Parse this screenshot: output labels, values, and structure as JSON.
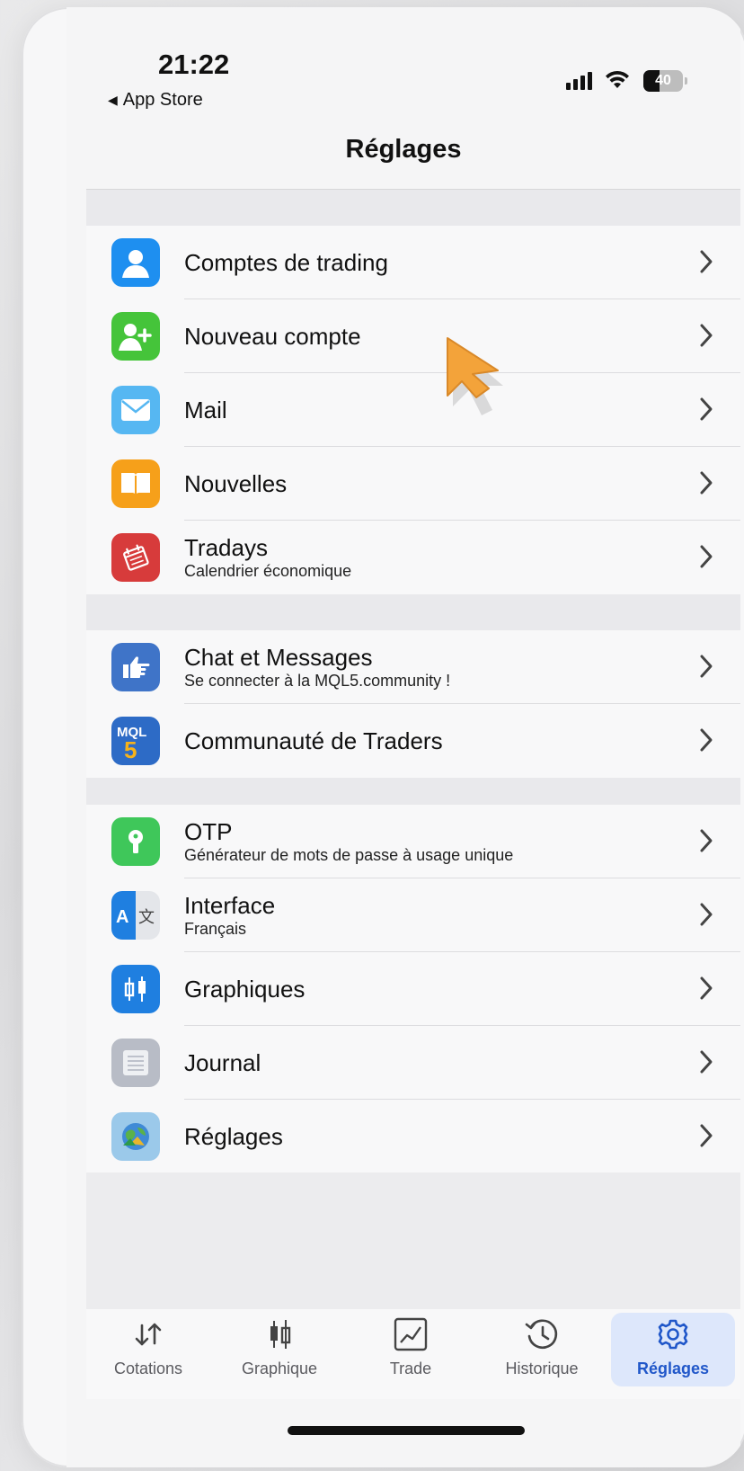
{
  "status_bar": {
    "time": "21:22",
    "back_label": "App Store",
    "battery": "40"
  },
  "nav": {
    "title": "Réglages"
  },
  "groups": [
    {
      "items": [
        {
          "title": "Comptes de trading",
          "subtitle": "",
          "icon": "person-icon",
          "color": "#1e8ff0"
        },
        {
          "title": "Nouveau compte",
          "subtitle": "",
          "icon": "add-person-icon",
          "color": "#45c43a"
        },
        {
          "title": "Mail",
          "subtitle": "",
          "icon": "mail-icon",
          "color": "#56b7f2"
        },
        {
          "title": "Nouvelles",
          "subtitle": "",
          "icon": "book-icon",
          "color": "#f6a01a"
        },
        {
          "title": "Tradays",
          "subtitle": "Calendrier économique",
          "icon": "calendar-icon",
          "color": "#d73b3b"
        }
      ]
    },
    {
      "items": [
        {
          "title": "Chat et Messages",
          "subtitle": "Se connecter à la MQL5.community !",
          "icon": "hand-pointer-icon",
          "color": "#3f74c8"
        },
        {
          "title": "Communauté de Traders",
          "subtitle": "",
          "icon": "mql5-icon",
          "color": "#2d6bc6"
        }
      ]
    },
    {
      "items": [
        {
          "title": "OTP",
          "subtitle": "Générateur de mots de passe à usage unique",
          "icon": "key-icon",
          "color": "#3fc75a"
        },
        {
          "title": "Interface",
          "subtitle": "Français",
          "icon": "translate-icon",
          "color": "#1f7fe0"
        },
        {
          "title": "Graphiques",
          "subtitle": "",
          "icon": "candles-icon",
          "color": "#1f7fe0"
        },
        {
          "title": "Journal",
          "subtitle": "",
          "icon": "journal-icon",
          "color": "#b8bcc6"
        },
        {
          "title": "Réglages",
          "subtitle": "",
          "icon": "metatrader-icon",
          "color": "#9bc9ea"
        }
      ]
    }
  ],
  "tabbar": {
    "tabs": [
      {
        "label": "Cotations",
        "icon": "arrows-updown-icon"
      },
      {
        "label": "Graphique",
        "icon": "candlestick-icon"
      },
      {
        "label": "Trade",
        "icon": "trade-chart-icon"
      },
      {
        "label": "Historique",
        "icon": "history-icon"
      },
      {
        "label": "Réglages",
        "icon": "gear-icon",
        "active": true
      }
    ],
    "active_color": "#2057c9"
  }
}
